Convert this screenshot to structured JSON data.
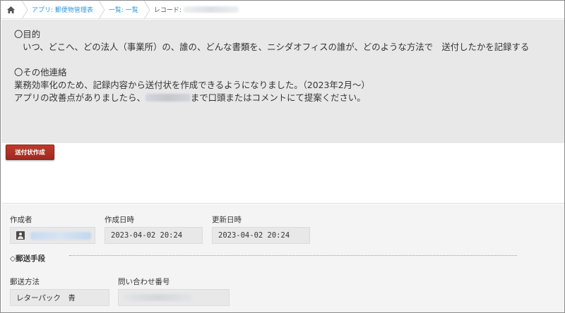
{
  "breadcrumb": {
    "app_label": "アプリ: 郵便物管理表",
    "view_label": "一覧: 一覧",
    "record_label": "レコード:"
  },
  "notice": {
    "purpose_heading": "〇目的",
    "purpose_text": "いつ、どこへ、どの法人（事業所）の、誰の、どんな書類を、ニシダオフィスの誰が、どのような方法で　送付したかを記録する",
    "other_heading": "〇その他連絡",
    "other_line1": "業務効率化のため、記録内容から送付状を作成できるようになりました。（2023年2月〜）",
    "other_line2_prefix": "アプリの改善点がありましたら、",
    "other_line2_suffix": "まで口頭またはコメントにて提案ください。"
  },
  "actions": {
    "create_letter_label": "送付状作成"
  },
  "record": {
    "creator_label": "作成者",
    "created_label": "作成日時",
    "created_value": "2023-04-02 20:24",
    "updated_label": "更新日時",
    "updated_value": "2023-04-02 20:24",
    "group_label": "◇郵送手段",
    "method_label": "郵送方法",
    "method_value": "レターパック　青",
    "tracking_label": "問い合わせ番号"
  },
  "colors": {
    "accent_red": "#a93226",
    "link_blue": "#3498db",
    "notice_bg": "#e8e8e8"
  },
  "icons": [
    "home-icon",
    "user-icon"
  ]
}
